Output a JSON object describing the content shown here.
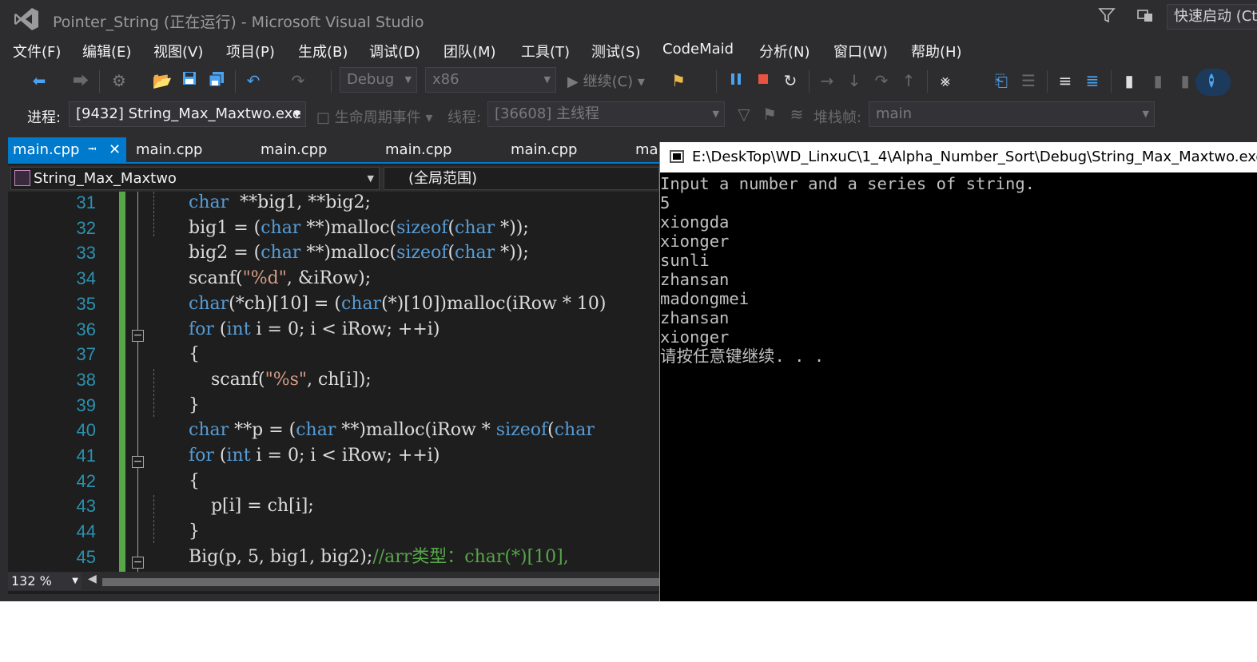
{
  "window": {
    "title": "Pointer_String (正在运行) - Microsoft Visual Studio",
    "quick_launch": "快速启动 (Ct"
  },
  "menu": [
    "文件(F)",
    "编辑(E)",
    "视图(V)",
    "项目(P)",
    "生成(B)",
    "调试(D)",
    "团队(M)",
    "工具(T)",
    "测试(S)",
    "CodeMaid",
    "分析(N)",
    "窗口(W)",
    "帮助(H)"
  ],
  "toolbar": {
    "config": "Debug",
    "platform": "x86",
    "continue": "继续(C)"
  },
  "debug_location": {
    "process_label": "进程:",
    "process_value": "[9432] String_Max_Maxtwo.exe",
    "lifecycle": "生命周期事件",
    "thread_label": "线程:",
    "thread_value": "[36608] 主线程",
    "stack_label": "堆栈帧:",
    "stack_value": "main"
  },
  "editor": {
    "tabs": [
      "main.cpp",
      "main.cpp",
      "main.cpp",
      "main.cpp",
      "main.cpp",
      "mai"
    ],
    "project_scope": "String_Max_Maxtwo",
    "global_scope": "(全局范围)",
    "zoom": "132 %",
    "lines": [
      {
        "num": "31",
        "segs": [
          [
            "kw",
            "char"
          ],
          [
            "",
            "  **big1, **big2;"
          ]
        ]
      },
      {
        "num": "32",
        "segs": [
          [
            "",
            "big1 = ("
          ],
          [
            "kw",
            "char"
          ],
          [
            "",
            " **)malloc("
          ],
          [
            "kw",
            "sizeof"
          ],
          [
            "",
            "("
          ],
          [
            "kw",
            "char"
          ],
          [
            "",
            " *));"
          ]
        ]
      },
      {
        "num": "33",
        "segs": [
          [
            "",
            "big2 = ("
          ],
          [
            "kw",
            "char"
          ],
          [
            "",
            " **)malloc("
          ],
          [
            "kw",
            "sizeof"
          ],
          [
            "",
            "("
          ],
          [
            "kw",
            "char"
          ],
          [
            "",
            " *));"
          ]
        ]
      },
      {
        "num": "34",
        "segs": [
          [
            "",
            "scanf("
          ],
          [
            "str",
            "\"%d\""
          ],
          [
            "",
            ", &iRow);"
          ]
        ]
      },
      {
        "num": "35",
        "segs": [
          [
            "kw",
            "char"
          ],
          [
            "",
            "(*ch)[10] = ("
          ],
          [
            "kw",
            "char"
          ],
          [
            "",
            "(*)[10])malloc(iRow * 10)"
          ]
        ]
      },
      {
        "num": "36",
        "segs": [
          [
            "kw",
            "for"
          ],
          [
            "",
            " ("
          ],
          [
            "kw",
            "int"
          ],
          [
            "",
            " i = 0; i < iRow; ++i)"
          ]
        ]
      },
      {
        "num": "37",
        "segs": [
          [
            "",
            "{"
          ]
        ]
      },
      {
        "num": "38",
        "segs": [
          [
            "",
            "    scanf("
          ],
          [
            "str",
            "\"%s\""
          ],
          [
            "",
            ", ch[i]);"
          ]
        ]
      },
      {
        "num": "39",
        "segs": [
          [
            "",
            "}"
          ]
        ]
      },
      {
        "num": "40",
        "segs": [
          [
            "kw",
            "char"
          ],
          [
            "",
            " **p = ("
          ],
          [
            "kw",
            "char"
          ],
          [
            "",
            " **)malloc(iRow * "
          ],
          [
            "kw",
            "sizeof"
          ],
          [
            "",
            "("
          ],
          [
            "kw",
            "char"
          ]
        ]
      },
      {
        "num": "41",
        "segs": [
          [
            "kw",
            "for"
          ],
          [
            "",
            " ("
          ],
          [
            "kw",
            "int"
          ],
          [
            "",
            " i = 0; i < iRow; ++i)"
          ]
        ]
      },
      {
        "num": "42",
        "segs": [
          [
            "",
            "{"
          ]
        ]
      },
      {
        "num": "43",
        "segs": [
          [
            "",
            "    p[i] = ch[i];"
          ]
        ]
      },
      {
        "num": "44",
        "segs": [
          [
            "",
            "}"
          ]
        ]
      },
      {
        "num": "45",
        "segs": [
          [
            "",
            "Big(p, 5, big1, big2);"
          ],
          [
            "cm",
            "//arr类型：char(*)[10],"
          ]
        ]
      }
    ]
  },
  "console": {
    "title": "E:\\DeskTop\\WD_LinxuC\\1_4\\Alpha_Number_Sort\\Debug\\String_Max_Maxtwo.exe",
    "lines": [
      "Input a number and a series of string.",
      "5",
      "xiongda",
      "xionger",
      "sunli",
      "zhansan",
      "madongmei",
      "zhansan",
      "xionger",
      "请按任意键继续. . ."
    ]
  },
  "colors": {
    "accent": "#007acc",
    "keyword": "#569cd6",
    "string": "#d69d85",
    "comment": "#57a64a",
    "line_number": "#2b91af"
  }
}
